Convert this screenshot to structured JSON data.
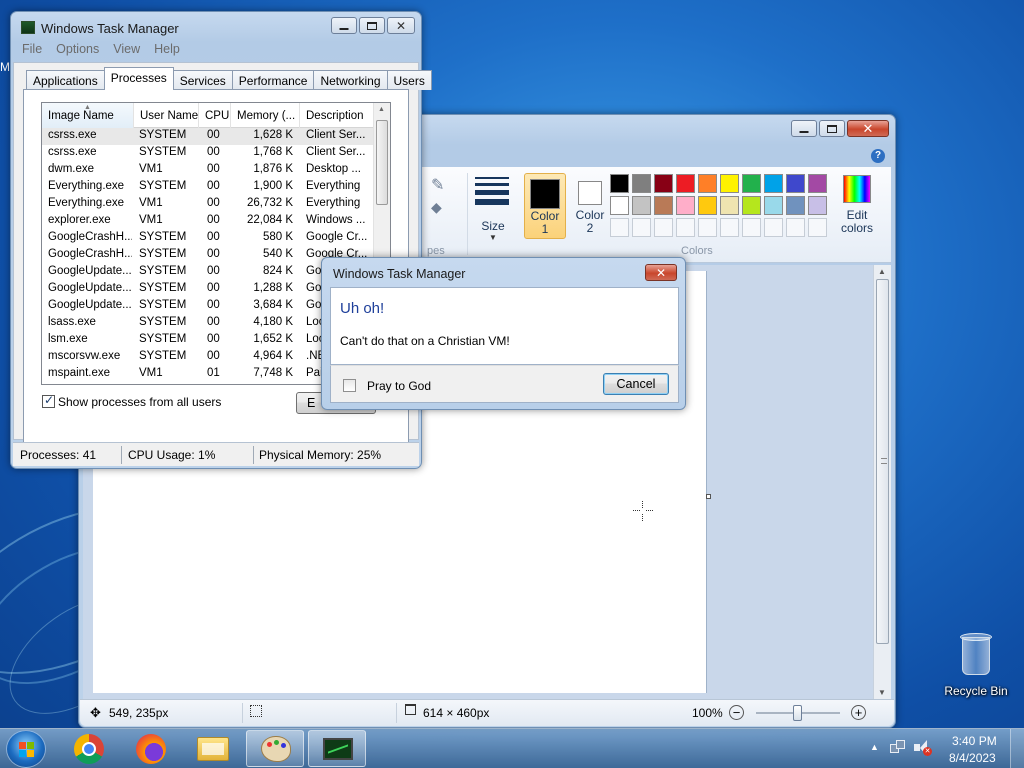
{
  "taskmgr": {
    "title": "Windows Task Manager",
    "menu": [
      "File",
      "Options",
      "View",
      "Help"
    ],
    "tabs": [
      "Applications",
      "Processes",
      "Services",
      "Performance",
      "Networking",
      "Users"
    ],
    "columns": [
      "Image Name",
      "User Name",
      "CPU",
      "Memory (...",
      "Description"
    ],
    "rows": [
      [
        "csrss.exe",
        "SYSTEM",
        "00",
        "1,628 K",
        "Client Ser..."
      ],
      [
        "csrss.exe",
        "SYSTEM",
        "00",
        "1,768 K",
        "Client Ser..."
      ],
      [
        "dwm.exe",
        "VM1",
        "00",
        "1,876 K",
        "Desktop ..."
      ],
      [
        "Everything.exe",
        "SYSTEM",
        "00",
        "1,900 K",
        "Everything"
      ],
      [
        "Everything.exe",
        "VM1",
        "00",
        "26,732 K",
        "Everything"
      ],
      [
        "explorer.exe",
        "VM1",
        "00",
        "22,084 K",
        "Windows ..."
      ],
      [
        "GoogleCrashH...",
        "SYSTEM",
        "00",
        "580 K",
        "Google Cr..."
      ],
      [
        "GoogleCrashH...",
        "SYSTEM",
        "00",
        "540 K",
        "Google Cr..."
      ],
      [
        "GoogleUpdate...",
        "SYSTEM",
        "00",
        "824 K",
        "Goo"
      ],
      [
        "GoogleUpdate...",
        "SYSTEM",
        "00",
        "1,288 K",
        "Goo"
      ],
      [
        "GoogleUpdate...",
        "SYSTEM",
        "00",
        "3,684 K",
        "Goo"
      ],
      [
        "lsass.exe",
        "SYSTEM",
        "00",
        "4,180 K",
        "Loc"
      ],
      [
        "lsm.exe",
        "SYSTEM",
        "00",
        "1,652 K",
        "Loc"
      ],
      [
        "mscorsvw.exe",
        "SYSTEM",
        "00",
        "4,964 K",
        ".NE"
      ],
      [
        "mspaint.exe",
        "VM1",
        "01",
        "7,748 K",
        "Pai"
      ]
    ],
    "show_all_label": "Show processes from all users",
    "show_all_checked": true,
    "end_button": "E",
    "status": {
      "processes": "Processes: 41",
      "cpu": "CPU Usage: 1%",
      "memory": "Physical Memory: 25%"
    }
  },
  "dialog": {
    "title": "Windows Task Manager",
    "heading": "Uh oh!",
    "message": "Can't do that on a Christian VM!",
    "checkbox_label": "Pray to God",
    "cancel": "Cancel"
  },
  "paint": {
    "size_label": "Size",
    "color1_label": "Color\n1",
    "color2_label": "Color\n2",
    "colors_group": "Colors",
    "edit_colors_label": "Edit\ncolors",
    "shapes_group_fragment": "pes",
    "color1_value": "#000000",
    "color2_value": "#ffffff",
    "palette_row1": [
      "#000000",
      "#7f7f7f",
      "#880015",
      "#ed1c24",
      "#ff7f27",
      "#fff200",
      "#22b14c",
      "#00a2e8",
      "#3f48cc",
      "#a349a4"
    ],
    "palette_row2": [
      "#ffffff",
      "#c3c3c3",
      "#b97a57",
      "#ffaec9",
      "#ffc90e",
      "#efe4b0",
      "#b5e61d",
      "#99d9ea",
      "#7092be",
      "#c8bfe7"
    ],
    "status": {
      "cursor": "549, 235px",
      "size": "614 × 460px",
      "zoom": "100%"
    }
  },
  "desktop": {
    "recycle_bin": "Recycle Bin",
    "clock_time": "3:40 PM",
    "clock_date": "8/4/2023",
    "edge_fragment": "M"
  }
}
